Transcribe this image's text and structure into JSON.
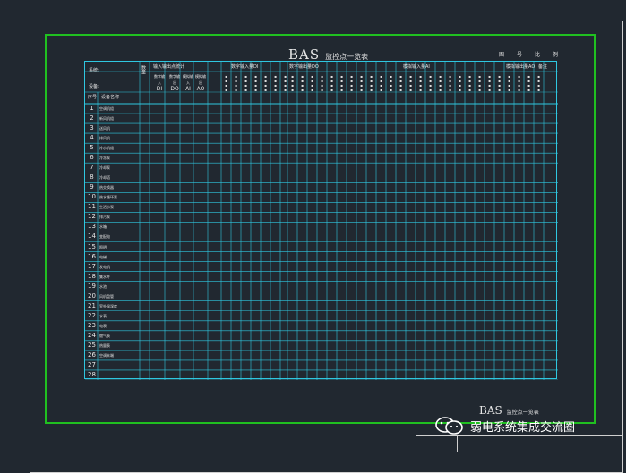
{
  "title": {
    "main": "BAS",
    "sub": "监控点一览表"
  },
  "corner_marks": [
    "图",
    "号",
    "比",
    "例"
  ],
  "header": {
    "system_label": "系统:",
    "equipment_label": "设备:",
    "no_label": "序号",
    "name_label": "设备名称",
    "qty_label": "数量",
    "groups": [
      "输入输出点统计",
      "数字输入量DI",
      "数字输出量DO",
      "模拟输入量AI",
      "模拟输出量AO",
      "备注"
    ],
    "sub_labels": [
      [
        "数字输入",
        "DI"
      ],
      [
        "数字输出",
        "DO"
      ],
      [
        "模拟输入",
        "AI"
      ],
      [
        "模拟输出",
        "AO"
      ]
    ]
  },
  "rows": [
    {
      "no": "1",
      "name": "空调机组"
    },
    {
      "no": "2",
      "name": "新风机组"
    },
    {
      "no": "3",
      "name": "送风机"
    },
    {
      "no": "4",
      "name": "排风机"
    },
    {
      "no": "5",
      "name": "冷水机组"
    },
    {
      "no": "6",
      "name": "冷冻泵"
    },
    {
      "no": "7",
      "name": "冷却泵"
    },
    {
      "no": "8",
      "name": "冷却塔"
    },
    {
      "no": "9",
      "name": "热交换器"
    },
    {
      "no": "10",
      "name": "热水循环泵"
    },
    {
      "no": "11",
      "name": "生活水泵"
    },
    {
      "no": "12",
      "name": "排污泵"
    },
    {
      "no": "13",
      "name": "水箱"
    },
    {
      "no": "14",
      "name": "变配电"
    },
    {
      "no": "15",
      "name": "照明"
    },
    {
      "no": "16",
      "name": "电梯"
    },
    {
      "no": "17",
      "name": "发电机"
    },
    {
      "no": "18",
      "name": "集水井"
    },
    {
      "no": "19",
      "name": "水池"
    },
    {
      "no": "20",
      "name": "风机盘管"
    },
    {
      "no": "21",
      "name": "室外温湿度"
    },
    {
      "no": "22",
      "name": "水表"
    },
    {
      "no": "23",
      "name": "电表"
    },
    {
      "no": "24",
      "name": "燃气表"
    },
    {
      "no": "25",
      "name": "热量表"
    },
    {
      "no": "26",
      "name": "空调末端"
    },
    {
      "no": "27",
      "name": ""
    },
    {
      "no": "28",
      "name": ""
    }
  ],
  "stamp": {
    "main": "BAS",
    "sub": "监控点一览表"
  },
  "watermark": {
    "text": "弱电系统集成交流圈"
  },
  "colors": {
    "background": "#212830",
    "table": "#2fc7e0",
    "border_green": "#20c020"
  }
}
